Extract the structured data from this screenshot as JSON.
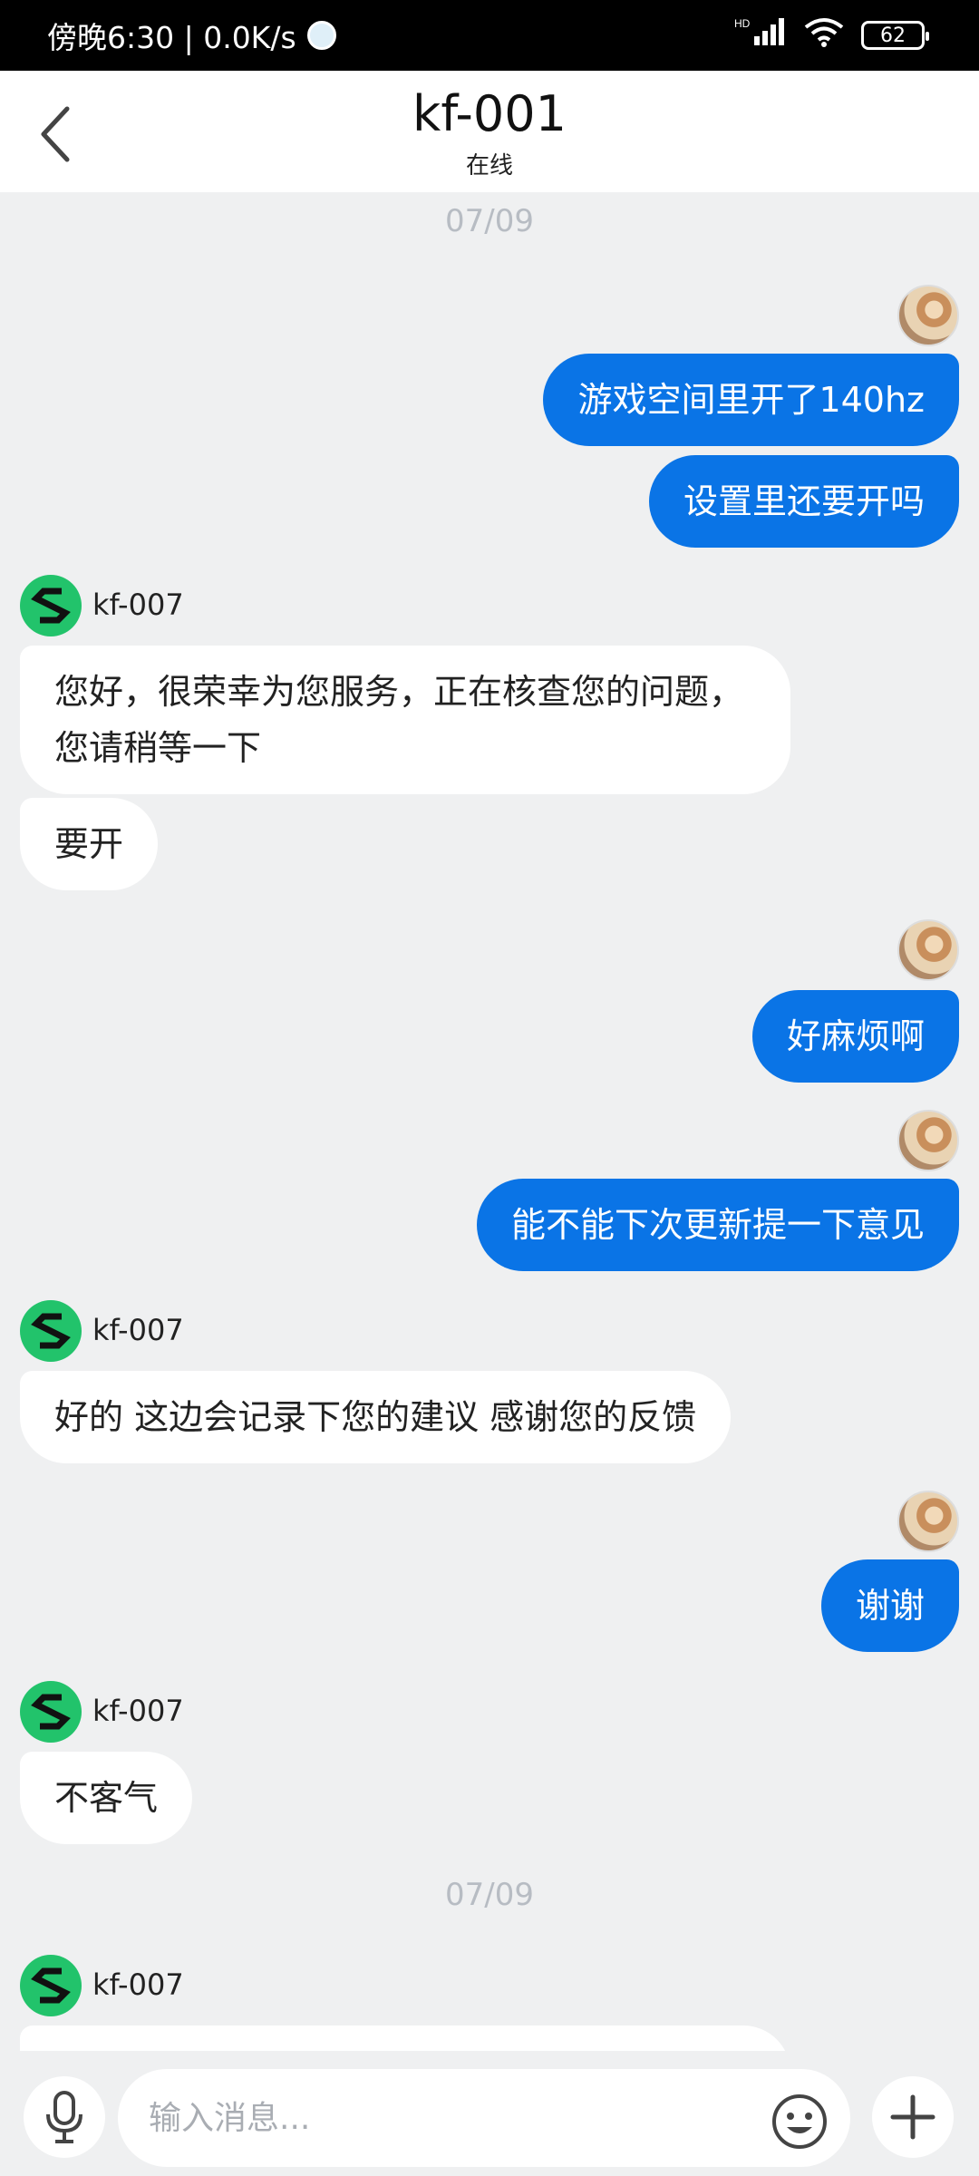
{
  "status_bar": {
    "time": "傍晚6:30 | 0.0K/s",
    "network_label": "HD",
    "battery": "62"
  },
  "header": {
    "title": "kf-001",
    "subtitle": "在线"
  },
  "chat": {
    "date_1": "07/09",
    "date_2": "07/09",
    "agent_name": "kf-007",
    "messages": [
      {
        "from": "me",
        "text": "游戏空间里开了140hz"
      },
      {
        "from": "me",
        "text": "设置里还要开吗"
      },
      {
        "from": "agent",
        "text": "您好，很荣幸为您服务，正在核查您的问题，您请稍等一下"
      },
      {
        "from": "agent",
        "text": "要开"
      },
      {
        "from": "me",
        "text": "好麻烦啊"
      },
      {
        "from": "me",
        "text": "能不能下次更新提一下意见"
      },
      {
        "from": "agent",
        "text": "好的 这边会记录下您的建议 感谢您的反馈"
      },
      {
        "from": "me",
        "text": "谢谢"
      },
      {
        "from": "agent",
        "text": "不客气"
      }
    ]
  },
  "input_bar": {
    "placeholder": "输入消息..."
  },
  "colors": {
    "my_bubble": "#0a74e6",
    "agent_avatar": "#22c36b",
    "background": "#eff0f1"
  },
  "icons": {
    "back": "chevron-left-icon",
    "mic": "microphone-icon",
    "emoji": "smiley-face-icon",
    "plus": "plus-icon"
  }
}
